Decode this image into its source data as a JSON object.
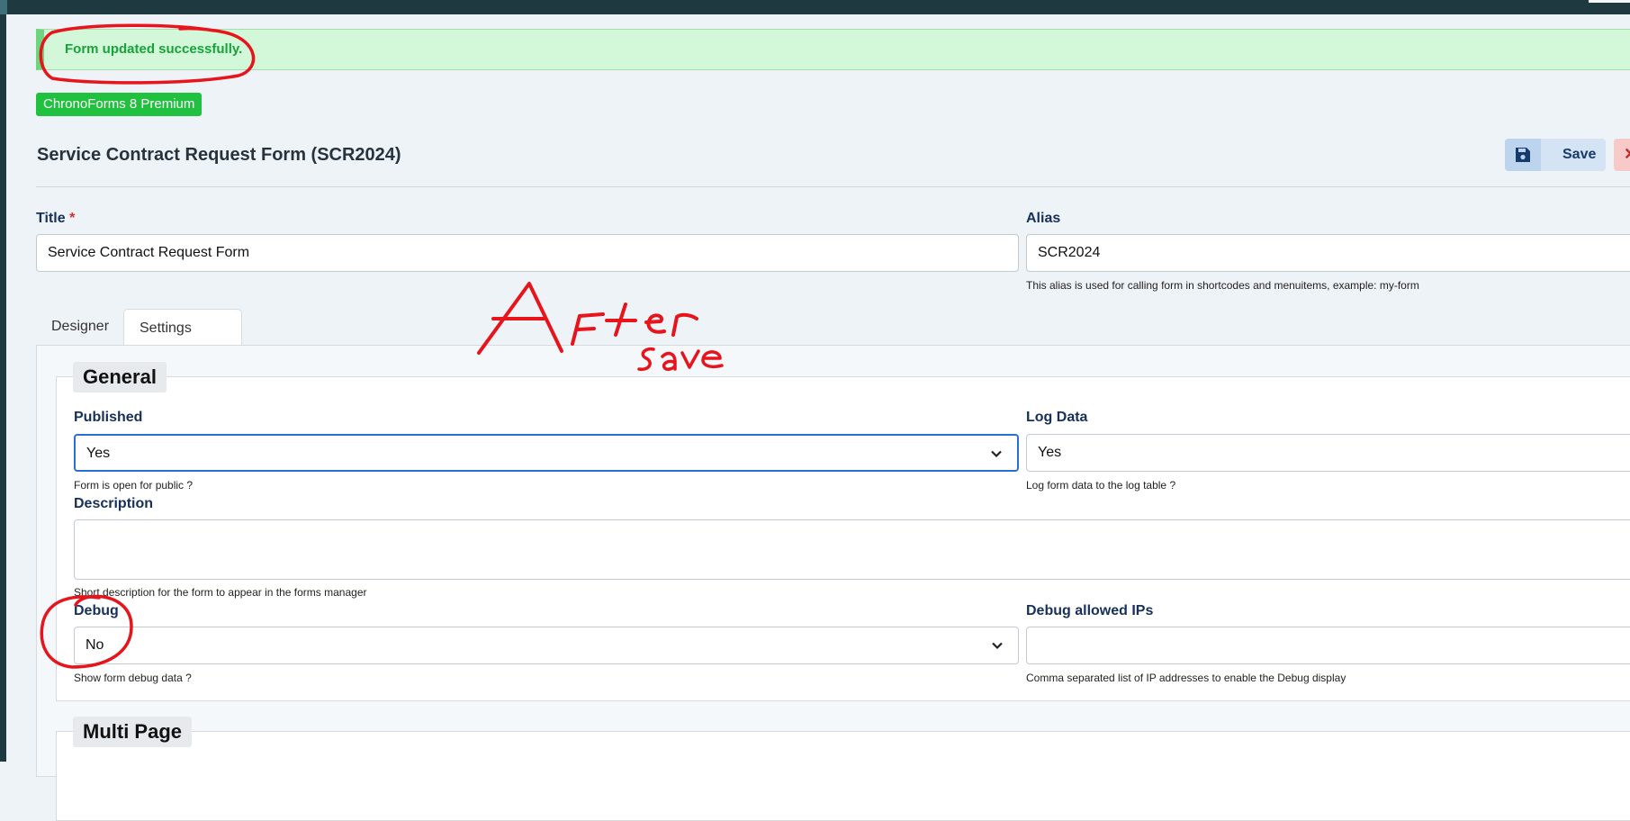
{
  "alert": {
    "message": "Form updated successfully."
  },
  "product_badge": "ChronoForms 8 Premium",
  "page_title": "Service Contract Request Form (SCR2024)",
  "toolbar": {
    "save_label": "Save",
    "close_glyph": "✕"
  },
  "form": {
    "title": {
      "label": "Title",
      "required_mark": "*",
      "value": "Service Contract Request Form"
    },
    "alias": {
      "label": "Alias",
      "value": "SCR2024",
      "hint": "This alias is used for calling form in shortcodes and menuitems, example: my-form"
    }
  },
  "tabs": [
    {
      "label": "Designer",
      "active": false
    },
    {
      "label": "Settings",
      "active": true
    }
  ],
  "settings": {
    "general": {
      "legend": "General",
      "published": {
        "label": "Published",
        "value": "Yes",
        "hint": "Form is open for public ?"
      },
      "log_data": {
        "label": "Log Data",
        "value": "Yes",
        "hint": "Log form data to the log table ?"
      },
      "description": {
        "label": "Description",
        "value": "",
        "hint": "Short description for the form to appear in the forms manager"
      },
      "debug": {
        "label": "Debug",
        "value": "No",
        "hint": "Show form debug data ?"
      },
      "debug_ips": {
        "label": "Debug allowed IPs",
        "value": "",
        "hint": "Comma separated list of IP addresses to enable the Debug display"
      }
    },
    "multi_page": {
      "legend": "Multi Page"
    }
  },
  "annotation": {
    "line1": "After",
    "line2": "save",
    "color": "#e8141b"
  },
  "colors": {
    "success_bg": "#d3f7d9",
    "success_text": "#17a33a",
    "badge_green": "#20c13e",
    "label_navy": "#16305a",
    "focus_blue": "#2a6fd6",
    "save_bg": "#d5e4f5"
  },
  "icons": {
    "save": "floppy-disk-icon",
    "close": "close-icon",
    "select": "chevron-down-icon"
  }
}
